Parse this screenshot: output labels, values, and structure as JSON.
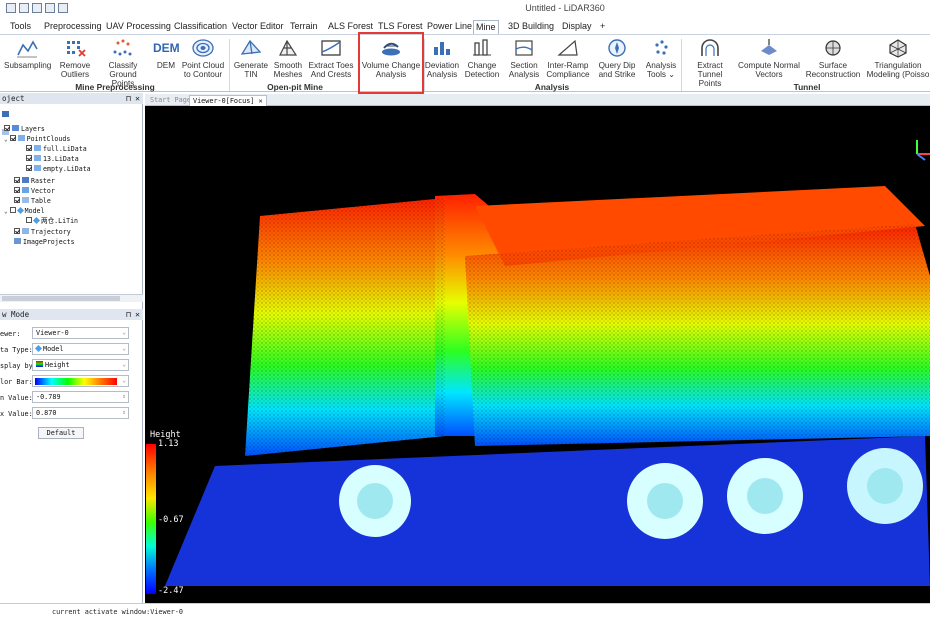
{
  "window": {
    "title": "Untitled - LiDAR360"
  },
  "menu": {
    "tabs": [
      "Tools",
      "Preprocessing",
      "UAV Processing",
      "Classification",
      "Vector Editor",
      "Terrain",
      "ALS Forest",
      "TLS Forest",
      "Power Line",
      "Mine",
      "3D Building",
      "Display",
      "+"
    ],
    "active": "Mine"
  },
  "ribbon": {
    "buttons": {
      "subsampling": "Subsampling",
      "remove_outliers": "Remove\nOutliers",
      "classify_ground": "Classify Ground\nPoints",
      "dem": "DEM",
      "dem_icon_text": "DEM",
      "point_cloud_contour": "Point Cloud\nto Contour",
      "generate_tin": "Generate\nTIN",
      "smooth_meshes": "Smooth\nMeshes",
      "extract_toes": "Extract Toes\nAnd Crests",
      "volume_change": "Volume Change\nAnalysis",
      "deviation": "Deviation\nAnalysis",
      "change_detection": "Change\nDetection",
      "section_analysis": "Section\nAnalysis",
      "inter_ramp": "Inter-Ramp\nCompliance",
      "query_dip": "Query Dip\nand Strike",
      "analysis_tools": "Analysis\nTools ⌄",
      "extract_tunnel": "Extract Tunnel\nPoints",
      "compute_normal": "Compute Normal\nVectors",
      "surface_recon": "Surface\nReconstruction",
      "triangulation": "Triangulation\nModeling (Poisso"
    },
    "groups": {
      "mine_preprocessing": "Mine Preprocessing",
      "open_pit": "Open-pit Mine",
      "analysis": "Analysis",
      "tunnel": "Tunnel"
    }
  },
  "project_panel": {
    "title": "oject",
    "tree": {
      "layers": "Layers",
      "pointclouds": "PointClouds",
      "full": "full.LiData",
      "f13": "13.LiData",
      "empty": "empty.LiData",
      "raster": "Raster",
      "vector": "Vector",
      "table": "Table",
      "model": "Model",
      "model_child": "两仓.LiTin",
      "trajectory": "Trajectory",
      "imageprojects": "ImageProjects"
    }
  },
  "display_panel": {
    "title": "w Mode",
    "viewer_label": "ewer:",
    "viewer_value": "Viewer-0",
    "datatype_label": "ta Type:",
    "datatype_value": "Model",
    "displayby_label": "splay by:",
    "displayby_value": "Height",
    "colorbar_label": "lor Bar:",
    "minvalue_label": "n Value:",
    "minvalue": "-0.789",
    "maxvalue_label": "x Value:",
    "maxvalue": "0.870",
    "default_button": "Default"
  },
  "viewer": {
    "tabs": [
      "Start Page",
      "Viewer-0[Focus]"
    ],
    "legend_title": "Height",
    "legend_max": "1.13",
    "legend_mid": "-0.67",
    "legend_min": "-2.47"
  },
  "status": {
    "text": "current activate window:Viewer-0"
  }
}
